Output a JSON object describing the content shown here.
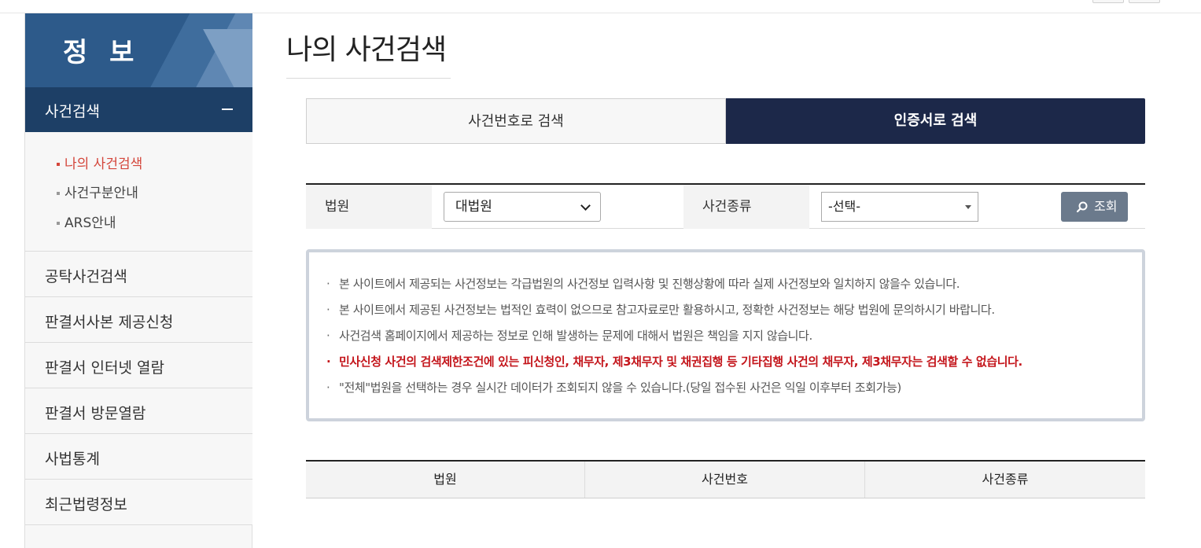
{
  "sidebar": {
    "title": "정 보",
    "active_menu": {
      "label": "사건검색"
    },
    "sub_items": [
      {
        "label": "나의 사건검색",
        "active": true
      },
      {
        "label": "사건구분안내",
        "active": false
      },
      {
        "label": "ARS안내",
        "active": false
      }
    ],
    "menu_items": [
      {
        "label": "공탁사건검색"
      },
      {
        "label": "판결서사본 제공신청"
      },
      {
        "label": "판결서 인터넷 열람"
      },
      {
        "label": "판결서 방문열람"
      },
      {
        "label": "사법통계"
      },
      {
        "label": "최근법령정보"
      }
    ]
  },
  "main": {
    "title": "나의 사건검색",
    "tabs": [
      {
        "label": "사건번호로 검색",
        "active": false
      },
      {
        "label": "인증서로 검색",
        "active": true
      }
    ],
    "search": {
      "court_label": "법원",
      "court_value": "대법원",
      "case_type_label": "사건종류",
      "case_type_value": "-선택-",
      "search_button": "조회"
    },
    "notice": [
      {
        "text": "본 사이트에서 제공되는 사건정보는 각급법원의 사건정보 입력사항 및 진행상황에 따라 실제 사건정보와 일치하지 않을수 있습니다.",
        "highlight": false
      },
      {
        "text": "본 사이트에서 제공된 사건정보는 법적인 효력이 없으므로 참고자료로만 활용하시고, 정확한 사건정보는 해당 법원에 문의하시기 바랍니다.",
        "highlight": false
      },
      {
        "text": "사건검색 홈페이지에서 제공하는 정보로 인해 발생하는 문제에 대해서 법원은 책임을 지지 않습니다.",
        "highlight": false
      },
      {
        "text": "민사신청 사건의 검색제한조건에 있는 피신청인, 채무자, 제3채무자 및 채권집행 등 기타집행 사건의 채무자, 제3채무자는 검색할 수 없습니다.",
        "highlight": true
      },
      {
        "text": "\"전체\"법원을 선택하는 경우 실시간 데이터가 조회되지 않을 수 있습니다.(당일 접수된 사건은 익일 이후부터 조회가능)",
        "highlight": false
      }
    ],
    "table": {
      "columns": [
        "법원",
        "사건번호",
        "사건종류"
      ]
    }
  },
  "colors": {
    "sidebar_header": "#2d5a8a",
    "active_menu": "#1d3f66",
    "active_tab": "#1c2849",
    "highlight_red": "#c4161c",
    "submenu_active": "#d4463b"
  }
}
